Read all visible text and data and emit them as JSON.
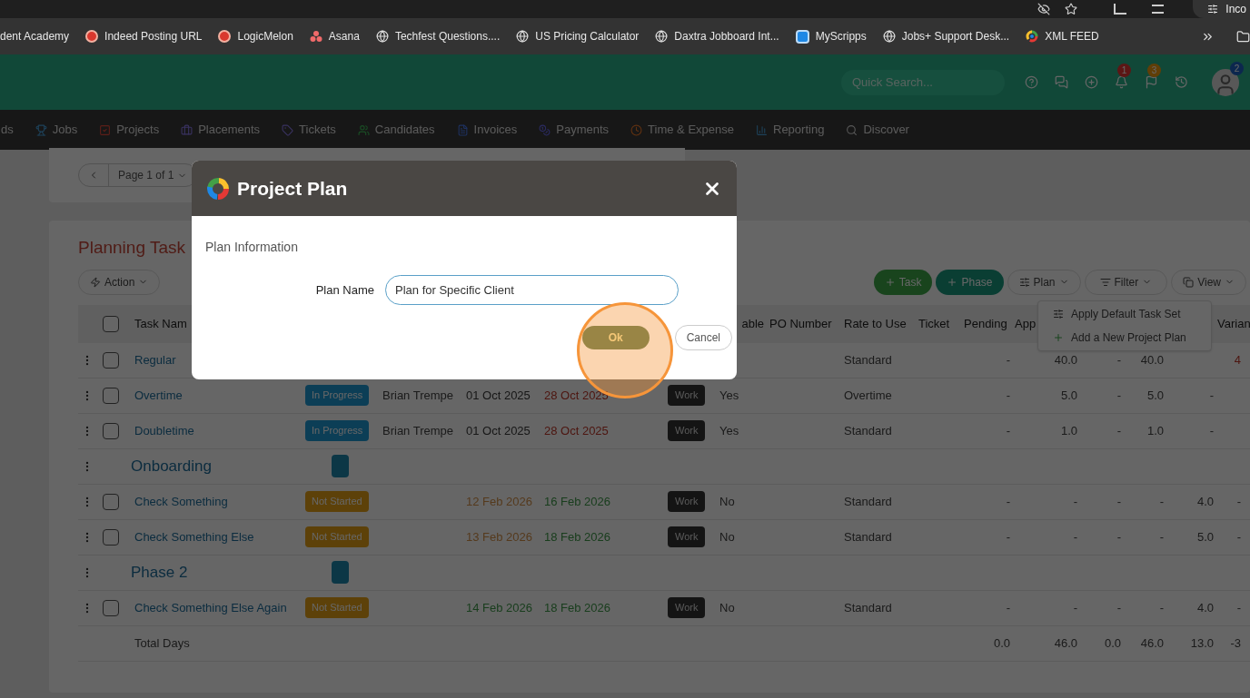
{
  "browser": {
    "profile_label": "Inco",
    "bookmarks": [
      {
        "label": "dent Academy",
        "kind": "none"
      },
      {
        "label": "Indeed Posting URL",
        "kind": "flame"
      },
      {
        "label": "LogicMelon",
        "kind": "flame"
      },
      {
        "label": "Asana",
        "kind": "dots"
      },
      {
        "label": "Techfest Questions....",
        "kind": "globe"
      },
      {
        "label": "US Pricing Calculator",
        "kind": "globe"
      },
      {
        "label": "Daxtra Jobboard Int...",
        "kind": "globe"
      },
      {
        "label": "MyScripps",
        "kind": "square"
      },
      {
        "label": "Jobs+ Support Desk...",
        "kind": "globe"
      },
      {
        "label": "XML FEED",
        "kind": "ring"
      }
    ]
  },
  "header": {
    "search_placeholder": "Quick Search...",
    "notifications_badge": "1",
    "flags_badge": "3",
    "avatar_badge": "2"
  },
  "nav": [
    {
      "label": "ds",
      "kind": "none"
    },
    {
      "label": "Jobs",
      "kind": "trophy"
    },
    {
      "label": "Projects",
      "kind": "check"
    },
    {
      "label": "Placements",
      "kind": "briefcase"
    },
    {
      "label": "Tickets",
      "kind": "tag"
    },
    {
      "label": "Candidates",
      "kind": "users"
    },
    {
      "label": "Invoices",
      "kind": "file"
    },
    {
      "label": "Payments",
      "kind": "coins"
    },
    {
      "label": "Time & Expense",
      "kind": "clock"
    },
    {
      "label": "Reporting",
      "kind": "chart"
    },
    {
      "label": "Discover",
      "kind": "search"
    }
  ],
  "pager": {
    "label": "Page 1 of 1"
  },
  "planning": {
    "title": "Planning Task",
    "action_button": "Action",
    "toolbar": [
      {
        "label": "Task",
        "kind": "task"
      },
      {
        "label": "Phase",
        "kind": "phase"
      },
      {
        "label": "Plan",
        "kind": "plan"
      },
      {
        "label": "Filter",
        "kind": "filter"
      },
      {
        "label": "View",
        "kind": "view"
      }
    ],
    "plan_menu": [
      {
        "label": "Apply Default Task Set",
        "kind": "apply"
      },
      {
        "label": "Add a New Project Plan",
        "kind": "add"
      }
    ],
    "select_all_checked": false,
    "columns": {
      "task_name": "Task Nam",
      "billable": "able",
      "po_number": "PO Number",
      "rate": "Rate to Use",
      "ticket": "Ticket",
      "pending": "Pending",
      "approved": "App",
      "variance": "Varian"
    },
    "rows": [
      {
        "kind": "task",
        "checked": false,
        "name": "Regular",
        "rate": "Standard",
        "pending": "-",
        "approved": "40.0",
        "c3": "-",
        "c4": "40.0",
        "variance": "4"
      },
      {
        "kind": "task",
        "checked": false,
        "name": "Overtime",
        "status": {
          "label": "In Progress",
          "kind": "in_progress"
        },
        "assignee": "Brian Trempe",
        "start": {
          "text": "01 Oct 2025",
          "kind": "normal"
        },
        "due": {
          "text": "28 Oct 2025",
          "kind": "late"
        },
        "type": "Work",
        "billable": "Yes",
        "rate": "Overtime",
        "pending": "-",
        "approved": "5.0",
        "c3": "-",
        "c4": "5.0",
        "c5": "-"
      },
      {
        "kind": "task",
        "checked": false,
        "name": "Doubletime",
        "status": {
          "label": "In Progress",
          "kind": "in_progress"
        },
        "assignee": "Brian Trempe",
        "start": {
          "text": "01 Oct 2025",
          "kind": "normal"
        },
        "due": {
          "text": "28 Oct 2025",
          "kind": "late"
        },
        "type": "Work",
        "billable": "Yes",
        "rate": "Standard",
        "pending": "-",
        "approved": "1.0",
        "c3": "-",
        "c4": "1.0",
        "c5": "-"
      },
      {
        "kind": "phase",
        "name": "Onboarding"
      },
      {
        "kind": "task",
        "checked": false,
        "name": "Check Something",
        "status": {
          "label": "Not Started",
          "kind": "not_started"
        },
        "start": {
          "text": "12 Feb 2026",
          "kind": "soon"
        },
        "due": {
          "text": "16 Feb 2026",
          "kind": "ok"
        },
        "type": "Work",
        "billable": "No",
        "rate": "Standard",
        "pending": "-",
        "approved": "-",
        "c3": "-",
        "c4": "-",
        "c5": "4.0",
        "variance": "-"
      },
      {
        "kind": "task",
        "checked": false,
        "name": "Check Something Else",
        "status": {
          "label": "Not Started",
          "kind": "not_started"
        },
        "start": {
          "text": "13 Feb 2026",
          "kind": "soon"
        },
        "due": {
          "text": "18 Feb 2026",
          "kind": "ok"
        },
        "type": "Work",
        "billable": "No",
        "rate": "Standard",
        "pending": "-",
        "approved": "-",
        "c3": "-",
        "c4": "-",
        "c5": "5.0",
        "variance": "-"
      },
      {
        "kind": "phase",
        "name": "Phase 2"
      },
      {
        "kind": "task",
        "checked": false,
        "name": "Check Something Else Again",
        "status": {
          "label": "Not Started",
          "kind": "not_started"
        },
        "start": {
          "text": "14 Feb 2026",
          "kind": "ok"
        },
        "due": {
          "text": "18 Feb 2026",
          "kind": "ok"
        },
        "type": "Work",
        "billable": "No",
        "rate": "Standard",
        "pending": "-",
        "approved": "-",
        "c3": "-",
        "c4": "-",
        "c5": "4.0",
        "variance": "-"
      },
      {
        "kind": "total",
        "name": "Total Days",
        "pending": "0.0",
        "approved": "46.0",
        "c3": "0.0",
        "c4": "46.0",
        "c5": "13.0",
        "variance": "-3"
      }
    ]
  },
  "dialog": {
    "title": "Project Plan",
    "section": "Plan Information",
    "field_label": "Plan Name",
    "field_value": "Plan for Specific Client",
    "ok_button": "Ok",
    "cancel_button": "Cancel",
    "ok_highlighted": true
  }
}
